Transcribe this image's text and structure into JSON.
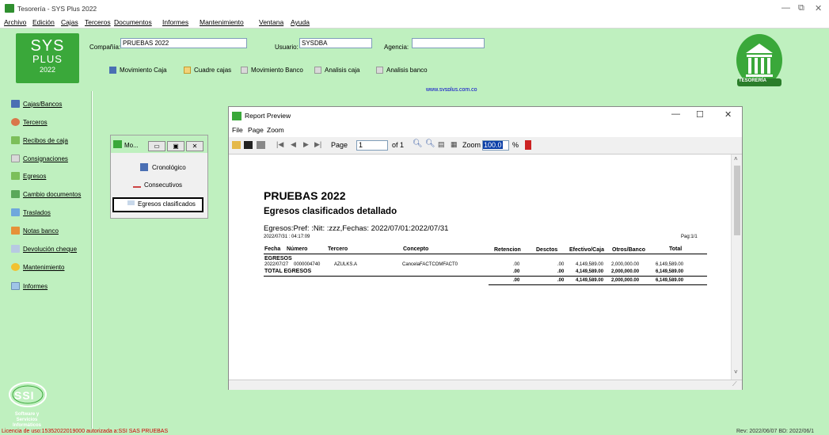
{
  "window": {
    "title": "Tesorería - SYS Plus 2022",
    "minimize": "—",
    "maximize": "⧉",
    "close": "✕"
  },
  "menu": [
    "Archivo",
    "Edición",
    "Cajas",
    "Terceros",
    "Documentos",
    "Informes",
    "Mantenimiento",
    "Ventana",
    "Ayuda"
  ],
  "logo": {
    "line1": "SYS",
    "line2": "PLUS",
    "line3": "2022"
  },
  "header": {
    "company_label": "Compañía:",
    "company_value": "PRUEBAS 2022",
    "user_label": "Usuario:",
    "user_value": "SYSDBA",
    "agency_label": "Agencia:",
    "agency_value": ""
  },
  "toolbar": {
    "movimiento_caja": "Movimiento Caja",
    "cuadre_cajas": "Cuadre cajas",
    "movimiento_banco": "Movimiento Banco",
    "analisis_caja": "Analisis caja",
    "analisis_banco": "Analisis banco",
    "website": "www.sysplus.com.co"
  },
  "tesoreria_label": "TESORERÍA",
  "sidebar": [
    "Cajas/Bancos",
    "Terceros",
    "Recibos de caja",
    "Consignaciones",
    "Egresos",
    "Cambio documentos",
    "Traslados",
    "Notas banco",
    "Devolución cheque",
    "Mantenimiento",
    "Informes"
  ],
  "ssi": {
    "text": "SSI",
    "caption": "Software y Servicios Informáticos"
  },
  "status": {
    "left": "Licencia de uso:15352022019000 autorizada a:SSI SAS PRUEBAS",
    "right": "Rev: 2022/06/07 BD: 2022/06/1"
  },
  "mini_window": {
    "title": "Mo...",
    "items": [
      "Cronológico",
      "Consecutivos",
      "Egresos clasificados"
    ]
  },
  "report_preview": {
    "title": "Report Preview",
    "menu": [
      "File",
      "Page",
      "Zoom"
    ],
    "page_label": "Page",
    "page_value": "1",
    "of_label": "of 1",
    "zoom_label": "Zoom",
    "zoom_value": "100.0",
    "percent": "%"
  },
  "report": {
    "company": "PRUEBAS 2022",
    "title": "Egresos clasificados detallado",
    "criteria": "Egresos:Pref: :Nit: :zzz,Fechas: 2022/07/01:2022/07/31",
    "timestamp": "2022/07/31 : 04:17:09",
    "page": "Pag:1/1",
    "columns": [
      "Fecha",
      "Número",
      "Tercero",
      "Concepto",
      "Retencion",
      "Desctos",
      "Efectivo/Caja",
      "Otros/Banco",
      "Total"
    ],
    "group": "EGRESOS",
    "row": {
      "fecha": "2022/07/27",
      "numero": "0000004740",
      "tercero": "AZULKS.A",
      "concepto": "CancelaFACTCOMFACT0",
      "retencion": ".00",
      "desctos": ".00",
      "efectivo": "4,149,589.00",
      "otros": "2,000,000.00",
      "total": "6,149,589.00"
    },
    "total_label": "TOTAL EGRESOS",
    "total": {
      "retencion": ".00",
      "desctos": ".00",
      "efectivo": "4,149,589.00",
      "otros": "2,000,000.00",
      "total": "6,149,589.00"
    },
    "grand": {
      "retencion": ".00",
      "desctos": ".00",
      "efectivo": "4,149,589.00",
      "otros": "2,000,000.00",
      "total": "6,149,589.00"
    }
  }
}
